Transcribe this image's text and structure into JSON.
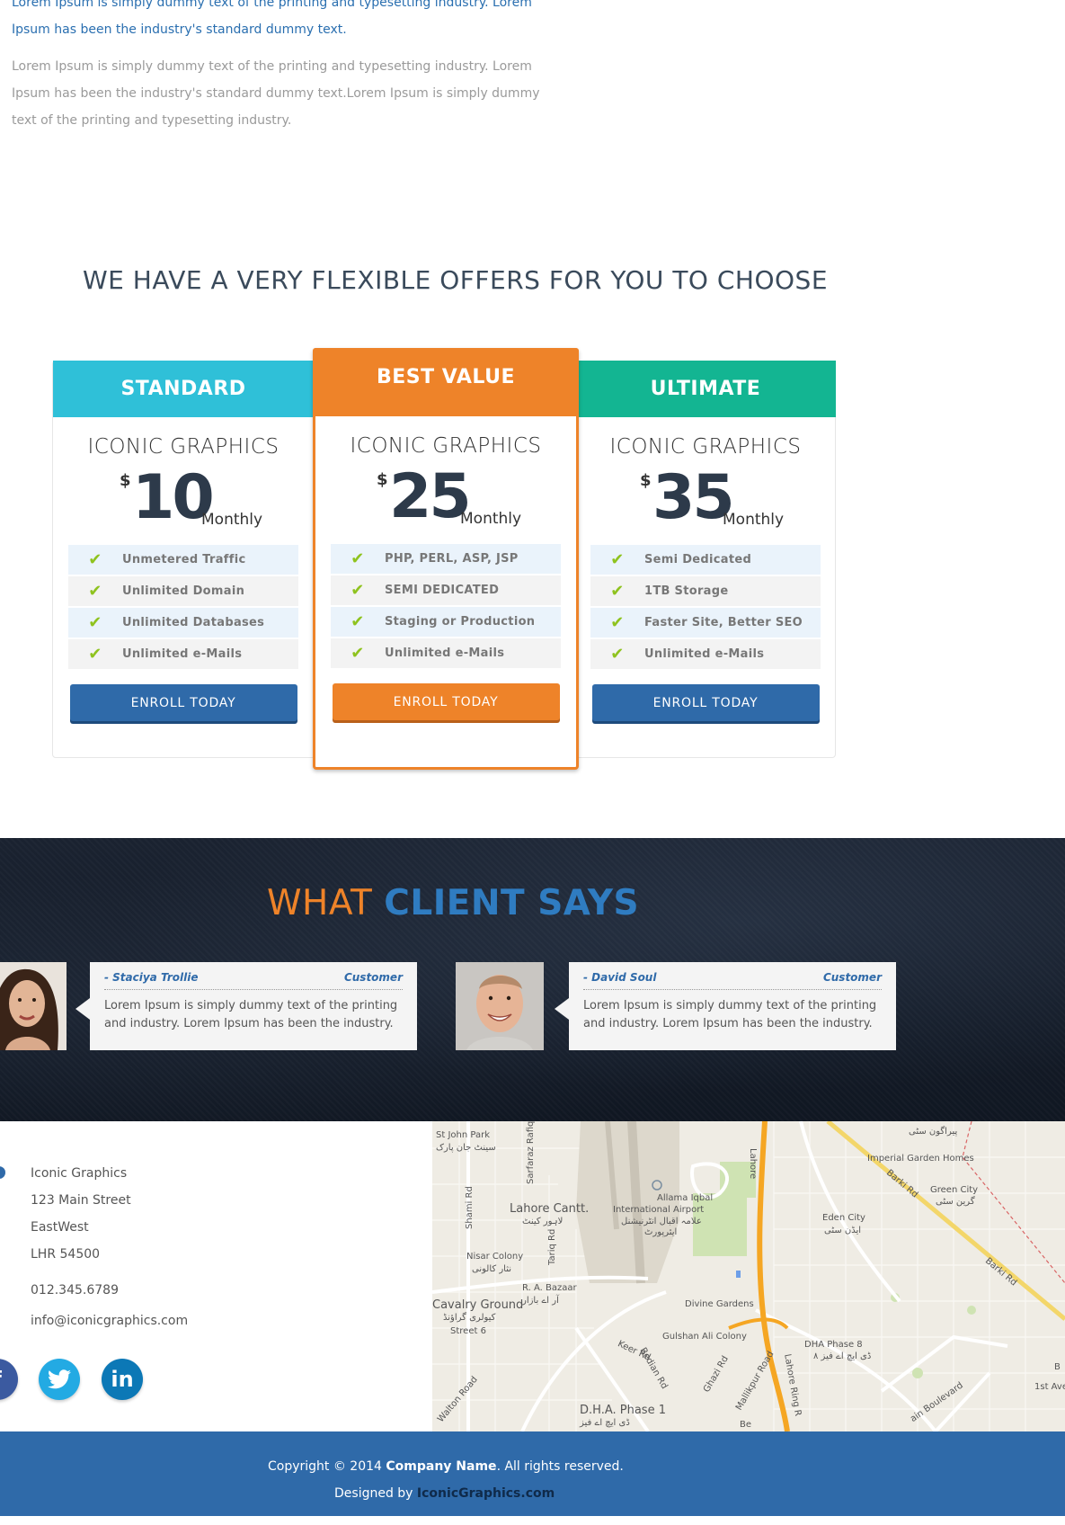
{
  "intro": {
    "highlight": "Lorem Ipsum is simply dummy text of the printing and typesetting industry. Lorem Ipsum has been the industry's standard dummy text.",
    "body": "Lorem Ipsum is simply dummy text of the printing and typesetting industry. Lorem Ipsum has been the industry's standard dummy text.Lorem Ipsum is simply dummy text of the printing and typesetting industry."
  },
  "pricing": {
    "heading": "WE HAVE A VERY FLEXIBLE OFFERS FOR YOU TO CHOOSE",
    "plans": [
      {
        "tier": "STANDARD",
        "name": "ICONIC GRAPHICS",
        "currency": "$",
        "amount": "10",
        "period": "Monthly",
        "features": [
          "Unmetered Traffic",
          "Unlimited Domain",
          "Unlimited Databases",
          "Unlimited e-Mails"
        ],
        "cta": "ENROLL TODAY",
        "color": "#2fc0d8"
      },
      {
        "tier": "BEST VALUE",
        "name": "ICONIC GRAPHICS",
        "currency": "$",
        "amount": "25",
        "period": "Monthly",
        "features": [
          "PHP, PERL, ASP, JSP",
          "SEMI DEDICATED",
          "Staging or Production",
          "Unlimited e-Mails"
        ],
        "cta": "ENROLL TODAY",
        "color": "#ee8329"
      },
      {
        "tier": "ULTIMATE",
        "name": "ICONIC GRAPHICS",
        "currency": "$",
        "amount": "35",
        "period": "Monthly",
        "features": [
          "Semi Dedicated",
          "1TB Storage",
          "Faster Site, Better SEO",
          "Unlimited e-Mails"
        ],
        "cta": "ENROLL TODAY",
        "color": "#13b592"
      }
    ]
  },
  "clients": {
    "title_part1": "WHAT ",
    "title_part2": "CLIENT SAYS",
    "testimonials": [
      {
        "name": "- Staciya Trollie",
        "role": "Customer",
        "text": "Lorem Ipsum is simply dummy text of the printing and industry. Lorem Ipsum has been the industry."
      },
      {
        "name": "- David Soul",
        "role": "Customer",
        "text": "Lorem Ipsum is simply dummy text of the printing and industry. Lorem Ipsum has been the industry."
      }
    ]
  },
  "contact": {
    "company": "Iconic Graphics",
    "street": "123 Main Street",
    "area": "EastWest",
    "postal": "LHR 54500",
    "phone": "012.345.6789",
    "email": "info@iconicgraphics.com",
    "social": [
      "f",
      "twitter-bird",
      "in"
    ]
  },
  "map": {
    "labels": {
      "st_john_park": "St John Park",
      "st_john_park_ur": "سینٹ جان پارک",
      "sarfaraz": "Sarfaraz Rafiqui",
      "shami_rd": "Shami Rd",
      "lahore_cantt": "Lahore Cantt.",
      "lahore_cantt_ur": "لاہور کینٹ",
      "airport": "Allama Iqbal",
      "airport2": "International Airport",
      "airport_ur": "علامہ اقبال انٹرنیشنل",
      "airport_ur2": "ایئرپورٹ",
      "nisar_colony": "Nisar Colony",
      "nisar_colony_ur": "نثار کالونی",
      "tariq_rd": "Tariq Rd",
      "ra_bazaar": "R. A. Bazaar",
      "ra_bazaar_ur": "آر اے بازار",
      "cavalry_ground": "Cavalry Ground",
      "cavalry_ground_ur": "کیولری گراؤنڈ",
      "street6": "Street 6",
      "lahore_top": "Lahore",
      "divine_gardens": "Divine Gardens",
      "gulshan": "Gulshan Ali Colony",
      "keer_rd": "Keer Rd",
      "bedian_rd": "Bedian Rd",
      "ghazi_rd": "Ghazi Rd",
      "mallikpur": "Mallikpur Road",
      "lahore_ring": "Lahore Ring R",
      "dha_phase1": "D.H.A. Phase 1",
      "dha_phase1_ur": "ڈی ایچ اے فیز",
      "dha_phase8": "DHA Phase 8",
      "dha_phase8_ur": "ڈی ایچ اے فیز ۸",
      "eden_city": "Eden City",
      "eden_city_ur": "ایڈن سٹی",
      "imperial": "Imperial Garden Homes",
      "green_city": "Green City",
      "green_city_ur": "گرین سٹی",
      "barki_rd": "Barki Rd",
      "barki_rd2": "Barki Rd",
      "paragon_ur": "پیراگون سٹی",
      "walton": "Walton Road",
      "ain_blvd": "ain Boulevard",
      "first_ave": "1st Ave",
      "b_label": "B",
      "be_label": "Be"
    },
    "colors": {
      "land": "#efece4",
      "road": "#ffffff",
      "highway": "#f5a623",
      "green": "#cfe3b3",
      "airport": "#ddd8cc"
    }
  },
  "footer": {
    "copyright_prefix": "Copyright © 2014 ",
    "company": "Company Name",
    "copyright_suffix": ". All rights reserved.",
    "designed_prefix": "Designed by ",
    "designer": "IconicGraphics.com"
  },
  "colors": {
    "primary_blue": "#2f6aa9",
    "orange": "#ee8329",
    "teal": "#13b592",
    "cyan": "#2fc0d8",
    "check_green": "#8fc31f"
  }
}
